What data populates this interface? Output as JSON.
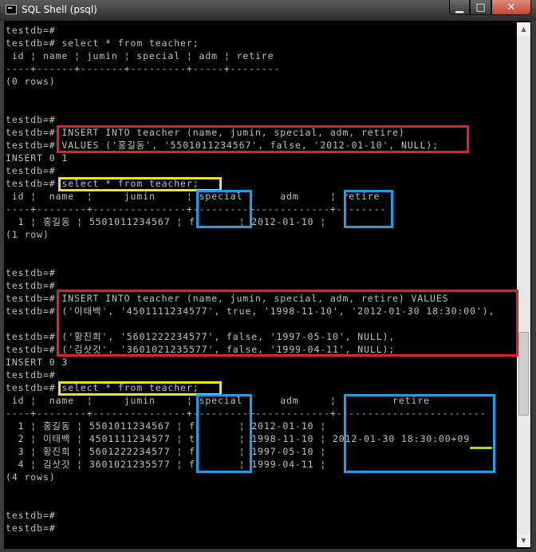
{
  "window": {
    "title": "SQL Shell (psql)",
    "minimize_glyph": "▁",
    "maximize_glyph": "□",
    "close_glyph": "✕"
  },
  "scrollbar": {
    "up_glyph": "▲",
    "down_glyph": "▼"
  },
  "console": {
    "lines": [
      "testdb=#",
      "testdb=# select * from teacher;",
      " id ¦ name ¦ jumin ¦ special ¦ adm ¦ retire",
      "----+------+-------+---------+-----+--------",
      "(0 rows)",
      "",
      "",
      "testdb=#",
      "testdb=# INSERT INTO teacher (name, jumin, special, adm, retire)",
      "testdb=# VALUES ('홍길동', '5501011234567', false, '2012-01-10', NULL);",
      "INSERT 0 1",
      "testdb=#",
      "testdb=# select * from teacher;",
      " id ¦  name  ¦     jumin     ¦ special ¦    adm     ¦ retire",
      "----+--------+---------------+---------+------------+--------",
      "  1 ¦ 홍길동 ¦ 5501011234567 ¦ f       ¦ 2012-01-10 ¦",
      "(1 row)",
      "",
      "",
      "testdb=#",
      "testdb=#",
      "testdb=# INSERT INTO teacher (name, jumin, special, adm, retire) VALUES",
      "testdb=# ('이태백', '4501111234577', true, '1998-11-10', '2012-01-30 18:30:00'),",
      "",
      "testdb=# ('황진희', '5601222234577', false, '1997-05-10', NULL),",
      "testdb=# ('김삿갓', '3601021235577', false, '1999-04-11', NULL);",
      "INSERT 0 3",
      "testdb=#",
      "testdb=# select * from teacher;",
      " id ¦  name  ¦     jumin     ¦ special ¦    adm     ¦         retire",
      "----+--------+---------------+---------+------------+------------------------",
      "  1 ¦ 홍길동 ¦ 5501011234567 ¦ f       ¦ 2012-01-10 ¦",
      "  2 ¦ 이태백 ¦ 4501111234577 ¦ t       ¦ 1998-11-10 ¦ 2012-01-30 18:30:00+09",
      "  3 ¦ 황진희 ¦ 5601222234577 ¦ f       ¦ 1997-05-10 ¦",
      "  4 ¦ 김삿갓 ¦ 3601021235577 ¦ f       ¦ 1999-04-11 ¦",
      "(4 rows)",
      "",
      "",
      "testdb=#",
      "testdb=#"
    ]
  },
  "colors": {
    "console_text": "#c0c0c0",
    "highlight_red": "#e0202a",
    "highlight_yellow": "#f0e020",
    "highlight_blue": "#1e9ee8",
    "underline_green": "#a8e020"
  }
}
